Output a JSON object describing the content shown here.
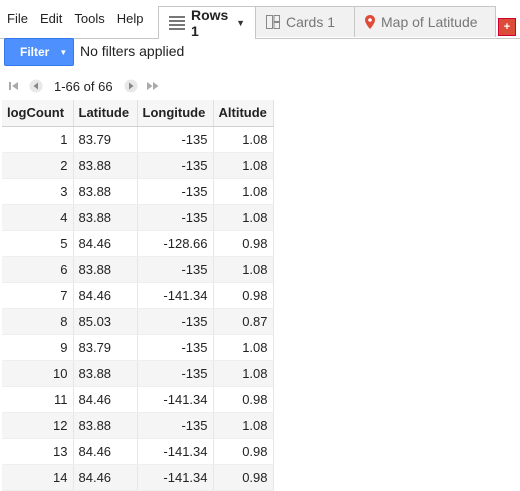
{
  "menu": {
    "items": [
      "File",
      "Edit",
      "Tools",
      "Help"
    ]
  },
  "tabs": {
    "rows": {
      "label": "Rows 1",
      "icon": "rows-list-icon"
    },
    "cards": {
      "label": "Cards 1",
      "icon": "cards-icon"
    },
    "map": {
      "label": "Map of Latitude",
      "icon": "map-pin-icon"
    },
    "add_label": "+"
  },
  "filter": {
    "button_label": "Filter",
    "status": "No filters applied"
  },
  "pager": {
    "range_text": "1-66 of 66"
  },
  "table": {
    "columns": [
      "logCount",
      "Latitude",
      "Longitude",
      "Altitude"
    ],
    "rows": [
      [
        "1",
        "83.79",
        "-135",
        "1.08"
      ],
      [
        "2",
        "83.88",
        "-135",
        "1.08"
      ],
      [
        "3",
        "83.88",
        "-135",
        "1.08"
      ],
      [
        "4",
        "83.88",
        "-135",
        "1.08"
      ],
      [
        "5",
        "84.46",
        "-128.66",
        "0.98"
      ],
      [
        "6",
        "83.88",
        "-135",
        "1.08"
      ],
      [
        "7",
        "84.46",
        "-141.34",
        "0.98"
      ],
      [
        "8",
        "85.03",
        "-135",
        "0.87"
      ],
      [
        "9",
        "83.79",
        "-135",
        "1.08"
      ],
      [
        "10",
        "83.88",
        "-135",
        "1.08"
      ],
      [
        "11",
        "84.46",
        "-141.34",
        "0.98"
      ],
      [
        "12",
        "83.88",
        "-135",
        "1.08"
      ],
      [
        "13",
        "84.46",
        "-141.34",
        "0.98"
      ],
      [
        "14",
        "84.46",
        "-141.34",
        "0.98"
      ]
    ]
  },
  "colors": {
    "accent": "#4d90fe",
    "add_tab": "#dd4b39",
    "map_pin": "#dd4b39"
  }
}
